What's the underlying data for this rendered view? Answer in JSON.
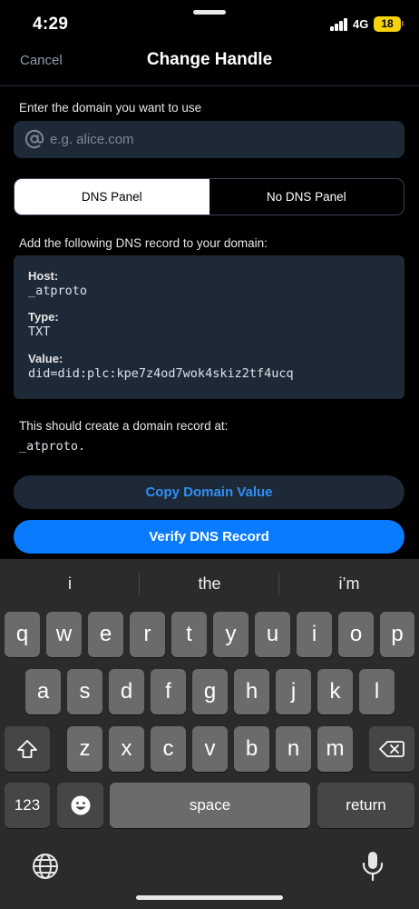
{
  "status_bar": {
    "time": "4:29",
    "network": "4G",
    "battery": "18"
  },
  "header": {
    "cancel_label": "Cancel",
    "title": "Change Handle"
  },
  "main": {
    "domain_prompt": "Enter the domain you want to use",
    "domain_input": {
      "value": "",
      "placeholder": "e.g. alice.com"
    },
    "tabs": [
      {
        "label": "DNS Panel",
        "selected": true
      },
      {
        "label": "No DNS Panel",
        "selected": false
      }
    ],
    "record_prompt": "Add the following DNS record to your domain:",
    "record": {
      "host_label": "Host:",
      "host_value": "_atproto",
      "type_label": "Type:",
      "type_value": "TXT",
      "value_label": "Value:",
      "value_value": "did=did:plc:kpe7z4od7wok4skiz2tf4ucq"
    },
    "result_prompt": "This should create a domain record at:",
    "result_value": "_atproto.",
    "copy_button": "Copy Domain Value",
    "verify_button": "Verify DNS Record"
  },
  "keyboard": {
    "suggestions": [
      "i",
      "the",
      "i’m"
    ],
    "row1": [
      "q",
      "w",
      "e",
      "r",
      "t",
      "y",
      "u",
      "i",
      "o",
      "p"
    ],
    "row2": [
      "a",
      "s",
      "d",
      "f",
      "g",
      "h",
      "j",
      "k",
      "l"
    ],
    "row3": [
      "z",
      "x",
      "c",
      "v",
      "b",
      "n",
      "m"
    ],
    "numbers_label": "123",
    "space_label": "space",
    "return_label": "return",
    "icons": [
      "shift-icon",
      "backspace-icon",
      "emoji-icon",
      "globe-icon",
      "microphone-icon"
    ]
  },
  "colors": {
    "accent": "#0a7bff",
    "link": "#2f8ff5",
    "panel": "#1e2937"
  }
}
